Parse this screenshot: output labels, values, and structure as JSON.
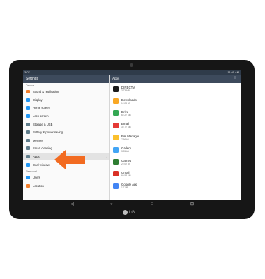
{
  "status": {
    "left": "3:07",
    "right": "11:05 AM"
  },
  "left_title": "Settings",
  "right_title": "Apps",
  "more_icon": "⋮",
  "section_device": "Device",
  "section_personal": "Personal",
  "menu": [
    {
      "label": "Sound & notification",
      "color": "#f27f2c"
    },
    {
      "label": "Display",
      "color": "#2196f3"
    },
    {
      "label": "Home screen",
      "color": "#2196f3"
    },
    {
      "label": "Lock screen",
      "color": "#2196f3"
    },
    {
      "label": "Storage & USB",
      "color": "#607d8b"
    },
    {
      "label": "Battery & power saving",
      "color": "#607d8b"
    },
    {
      "label": "Memory",
      "color": "#607d8b"
    },
    {
      "label": "Smart cleaning",
      "color": "#607d8b"
    },
    {
      "label": "Apps",
      "color": "#607d8b",
      "selected": true
    },
    {
      "label": "Dual window",
      "color": "#2196f3"
    }
  ],
  "menu2": [
    {
      "label": "Users",
      "color": "#2196f3"
    },
    {
      "label": "Location",
      "color": "#f27f2c"
    }
  ],
  "apps": [
    {
      "name": "DIRECTV",
      "size": "3.73 MB",
      "color": "#1b1b1b"
    },
    {
      "name": "Downloads",
      "size": "12.28 kB",
      "color": "#f9a825"
    },
    {
      "name": "Drive",
      "size": "62.27 MB",
      "color": "#34a853"
    },
    {
      "name": "Email",
      "size": "32.77 MB",
      "color": "#e53935"
    },
    {
      "name": "File Manager",
      "size": "7.66 kB",
      "color": "#fbc02d"
    },
    {
      "name": "Gallery",
      "size": "3.95 kB",
      "color": "#42a5f5"
    },
    {
      "name": "Games",
      "size": "22.02 kB",
      "color": "#2e7d32"
    },
    {
      "name": "Gmail",
      "size": "60.58 MB",
      "color": "#d93025"
    },
    {
      "name": "Google App",
      "size": "1.7 MB",
      "color": "#4285f4"
    }
  ],
  "nav": {
    "back": "◁",
    "home": "○",
    "recent": "□",
    "extra": "⊞"
  },
  "brand": "LG"
}
